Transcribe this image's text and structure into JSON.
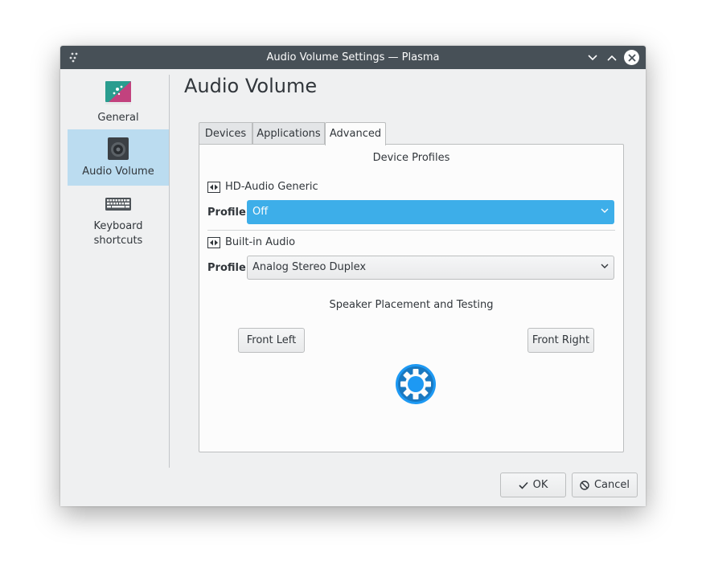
{
  "window": {
    "title": "Audio Volume Settings — Plasma"
  },
  "sidebar": {
    "items": [
      {
        "label": "General",
        "icon": "general-settings-icon",
        "active": false
      },
      {
        "label": "Audio Volume",
        "icon": "speaker-icon",
        "active": true
      },
      {
        "label": "Keyboard\nshortcuts",
        "label_line1": "Keyboard",
        "label_line2": "shortcuts",
        "icon": "keyboard-icon",
        "active": false
      }
    ]
  },
  "page": {
    "title": "Audio Volume"
  },
  "tabs": [
    {
      "label": "Devices",
      "active": false
    },
    {
      "label": "Applications",
      "active": false
    },
    {
      "label": "Advanced",
      "active": true
    }
  ],
  "advanced": {
    "device_profiles_heading": "Device Profiles",
    "cards": [
      {
        "name": "HD-Audio Generic",
        "profile_label": "Profile:",
        "profile_value": "Off",
        "focused": true
      },
      {
        "name": "Built-in Audio",
        "profile_label": "Profile:",
        "profile_value": "Analog Stereo Duplex",
        "focused": false
      }
    ],
    "speaker_heading": "Speaker Placement and Testing",
    "front_left_label": "Front Left",
    "front_right_label": "Front Right",
    "center_icon": "kde-logo-icon"
  },
  "footer": {
    "ok_label": "OK",
    "cancel_label": "Cancel"
  },
  "colors": {
    "titlebar": "#475057",
    "accent": "#3daee9",
    "sidebar_active": "#bbdcf0",
    "window_bg": "#eff0f1",
    "kde_blue": "#1d99f3"
  }
}
